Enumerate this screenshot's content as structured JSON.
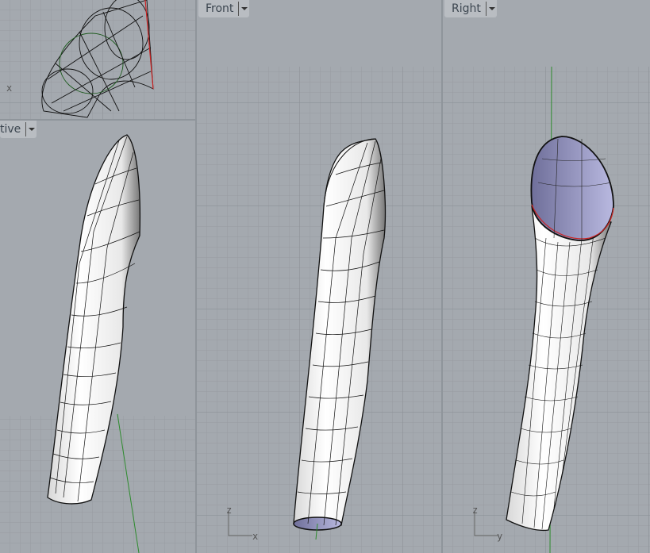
{
  "viewports": [
    {
      "name": "top",
      "axis_x": "x"
    },
    {
      "name": "perspective",
      "label": "tive"
    },
    {
      "name": "front",
      "label": "Front",
      "axis_v": "z",
      "axis_h": "x"
    },
    {
      "name": "right",
      "label": "Right",
      "axis_v": "z",
      "axis_h": "y"
    }
  ],
  "colors": {
    "background": "#a4a9af",
    "grid": "#979ca2",
    "grid_major": "#8b9096",
    "axis_green": "#2e8b2e",
    "edge_red": "#cc2222",
    "surface_inner": "#9a9ac8"
  }
}
